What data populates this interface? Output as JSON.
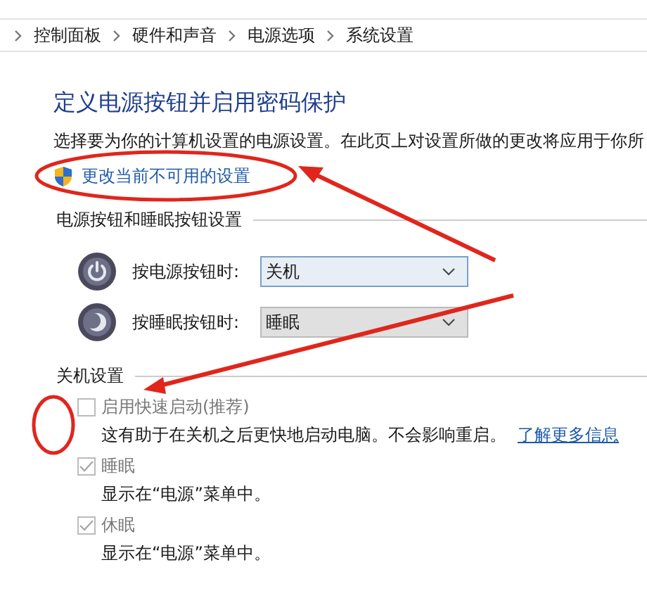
{
  "breadcrumb": [
    "控制面板",
    "硬件和声音",
    "电源选项",
    "系统设置"
  ],
  "title": "定义电源按钮并启用密码保护",
  "description": "选择要为你的计算机设置的电源设置。在此页上对设置所做的更改将应用于你所",
  "admin_link": "更改当前不可用的设置",
  "button_group": {
    "heading": "电源按钮和睡眠按钮设置",
    "rows": [
      {
        "kind": "power",
        "label": "按电源按钮时:",
        "value": "关机",
        "disabled": false
      },
      {
        "kind": "sleep",
        "label": "按睡眠按钮时:",
        "value": "睡眠",
        "disabled": true
      }
    ]
  },
  "shutdown_group": {
    "heading": "关机设置",
    "options": [
      {
        "label": "启用快速启动(推荐)",
        "checked": false,
        "disabled": true,
        "description": "这有助于在关机之后更快地启动电脑。不会影响重启。",
        "link": "了解更多信息"
      },
      {
        "label": "睡眠",
        "checked": true,
        "disabled": true,
        "description": "显示在“电源”菜单中。"
      },
      {
        "label": "休眠",
        "checked": true,
        "disabled": true,
        "description": "显示在“电源”菜单中。"
      }
    ]
  }
}
